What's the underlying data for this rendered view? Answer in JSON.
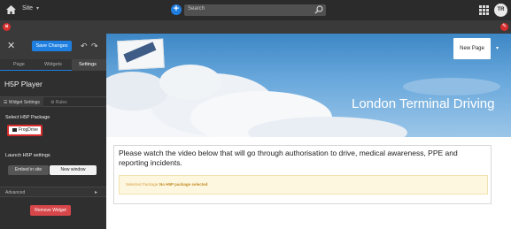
{
  "topbar": {
    "site_label": "Site",
    "search_placeholder": "Search",
    "avatar_initials": "TR",
    "icons": [
      "home-icon",
      "chevron-down-icon",
      "plus-icon",
      "search-icon",
      "apps-grid-icon"
    ]
  },
  "editbar": {
    "icons": [
      "close-icon",
      "pencil-icon"
    ]
  },
  "panel": {
    "save_label": "Save Changes",
    "tabs": [
      {
        "label": "Page",
        "active": false
      },
      {
        "label": "Widgets",
        "active": false
      },
      {
        "label": "Settings",
        "active": true
      }
    ],
    "title": "H5P Player",
    "subtabs": [
      {
        "label": "Widget Settings",
        "active": true
      },
      {
        "label": "Rules",
        "active": false
      }
    ],
    "select_package_label": "Select H5P Package",
    "frogdrive_label": "FrogDrive",
    "launch_label": "Launch H5P settings",
    "launch_options": [
      {
        "label": "Embed in site",
        "selected": false
      },
      {
        "label": "New window",
        "selected": true
      }
    ],
    "advanced_label": "Advanced",
    "remove_label": "Remove Widget"
  },
  "banner": {
    "new_page_label": "New Page",
    "title": "London Terminal Driving"
  },
  "content": {
    "description": "Please watch the video below that will go through authorisation to drive, medical awareness, PPE and reporting incidents.",
    "notice_label": "Selected Package:",
    "notice_value": "No H5P package selected"
  },
  "colors": {
    "topbar": "#2b2b2b",
    "panel": "#2f2f2f",
    "accent_blue": "#1f7fe0",
    "danger_red": "#d72d2d",
    "notice_bg": "#fdf7e0"
  }
}
